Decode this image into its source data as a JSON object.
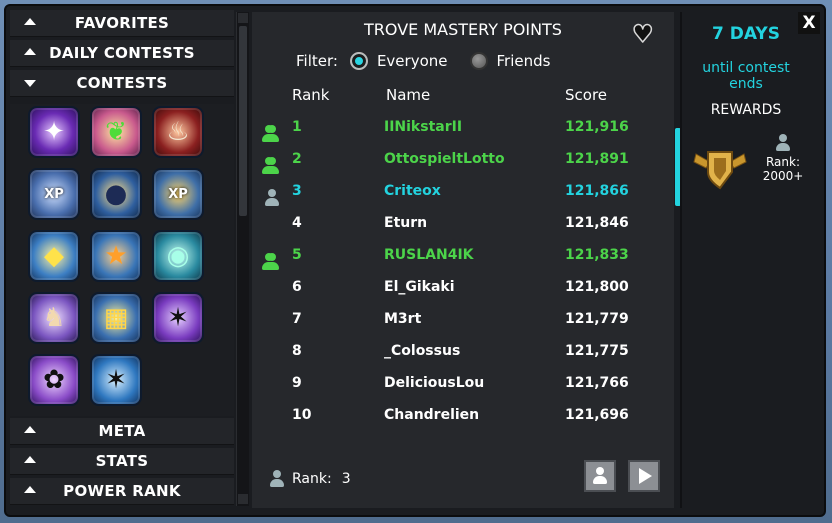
{
  "sidebar": {
    "sections": [
      {
        "label": "FAVORITES",
        "expanded": false
      },
      {
        "label": "DAILY CONTESTS",
        "expanded": false
      },
      {
        "label": "CONTESTS",
        "expanded": true
      },
      {
        "label": "META",
        "expanded": false
      },
      {
        "label": "STATS",
        "expanded": false
      },
      {
        "label": "POWER RANK",
        "expanded": false
      }
    ],
    "contest_icons": [
      {
        "name": "magic-star-icon",
        "glyph": "✦",
        "xp": ""
      },
      {
        "name": "sprout-icon",
        "glyph": "❦",
        "xp": ""
      },
      {
        "name": "meat-icon",
        "glyph": "♨",
        "xp": ""
      },
      {
        "name": "xp-wings-icon",
        "glyph": "",
        "xp": "XP"
      },
      {
        "name": "bomb-icon",
        "glyph": "●",
        "xp": ""
      },
      {
        "name": "xp-shield-icon",
        "glyph": "",
        "xp": "XP"
      },
      {
        "name": "winged-cube-icon",
        "glyph": "◆",
        "xp": ""
      },
      {
        "name": "star-wings-icon",
        "glyph": "★",
        "xp": ""
      },
      {
        "name": "orb-wings-icon",
        "glyph": "◉",
        "xp": ""
      },
      {
        "name": "dragon-icon",
        "glyph": "♞",
        "xp": ""
      },
      {
        "name": "gold-cube-icon",
        "glyph": "▦",
        "xp": ""
      },
      {
        "name": "jumping-figure-icon",
        "glyph": "✶",
        "xp": ""
      },
      {
        "name": "wheat-figure-icon",
        "glyph": "✿",
        "xp": ""
      },
      {
        "name": "leaping-figure-icon",
        "glyph": "✶",
        "xp": ""
      }
    ]
  },
  "main": {
    "title": "TROVE MASTERY POINTS",
    "filter_label": "Filter:",
    "filter_options": [
      "Everyone",
      "Friends"
    ],
    "filter_selected": "Everyone",
    "columns": {
      "rank": "Rank",
      "name": "Name",
      "score": "Score"
    },
    "rows": [
      {
        "rank": "1",
        "name": "IINikstarII",
        "score": "121,916",
        "style": "friend"
      },
      {
        "rank": "2",
        "name": "OttospieltLotto",
        "score": "121,891",
        "style": "friend"
      },
      {
        "rank": "3",
        "name": "Criteox",
        "score": "121,866",
        "style": "self"
      },
      {
        "rank": "4",
        "name": "Eturn",
        "score": "121,846",
        "style": "none"
      },
      {
        "rank": "5",
        "name": "RUSLAN4IK",
        "score": "121,833",
        "style": "friend"
      },
      {
        "rank": "6",
        "name": "El_Gikaki",
        "score": "121,800",
        "style": "none"
      },
      {
        "rank": "7",
        "name": "M3rt",
        "score": "121,779",
        "style": "none"
      },
      {
        "rank": "8",
        "name": "_Colossus",
        "score": "121,775",
        "style": "none"
      },
      {
        "rank": "9",
        "name": "DeliciousLou",
        "score": "121,766",
        "style": "none"
      },
      {
        "rank": "10",
        "name": "Chandrelien",
        "score": "121,696",
        "style": "none"
      }
    ],
    "my_rank_label": "Rank:",
    "my_rank_value": "3"
  },
  "right": {
    "days": "7 DAYS",
    "until": "until contest ends",
    "rewards_label": "REWARDS",
    "reward_rank_label": "Rank:",
    "reward_rank_value": "2000+"
  },
  "close_label": "X",
  "colors": {
    "friend": "#4cd44a",
    "self": "#23d3df",
    "accent": "#23d3df"
  }
}
